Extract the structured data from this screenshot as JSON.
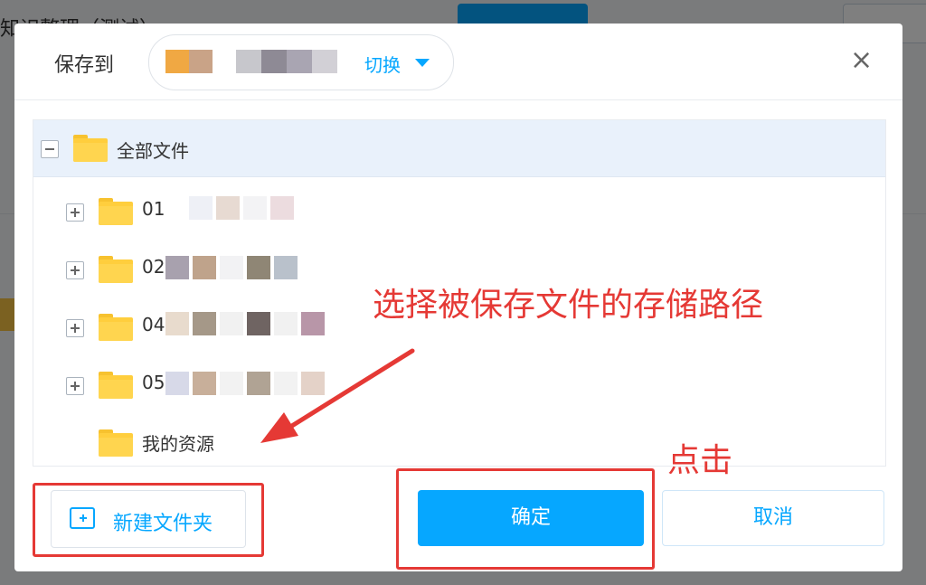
{
  "background": {
    "title_partial": "知识整理（测试）"
  },
  "dialog": {
    "save_to_label": "保存到",
    "switch_label": "切换",
    "close_icon": "close-icon",
    "tree": {
      "root_label": "全部文件",
      "items": [
        {
          "label": "01",
          "expandable": true
        },
        {
          "label": "02",
          "expandable": true
        },
        {
          "label": "04",
          "expandable": true
        },
        {
          "label": "05",
          "expandable": true
        },
        {
          "label": "我的资源",
          "expandable": false
        }
      ]
    },
    "buttons": {
      "new_folder": "新建文件夹",
      "confirm": "确定",
      "cancel": "取消"
    }
  },
  "annotations": {
    "path_hint": "选择被保存文件的存储路径",
    "click_hint": "点击"
  },
  "colors": {
    "accent": "#06a7ff",
    "annotation": "#e53935",
    "folder": "#ffce3d"
  }
}
